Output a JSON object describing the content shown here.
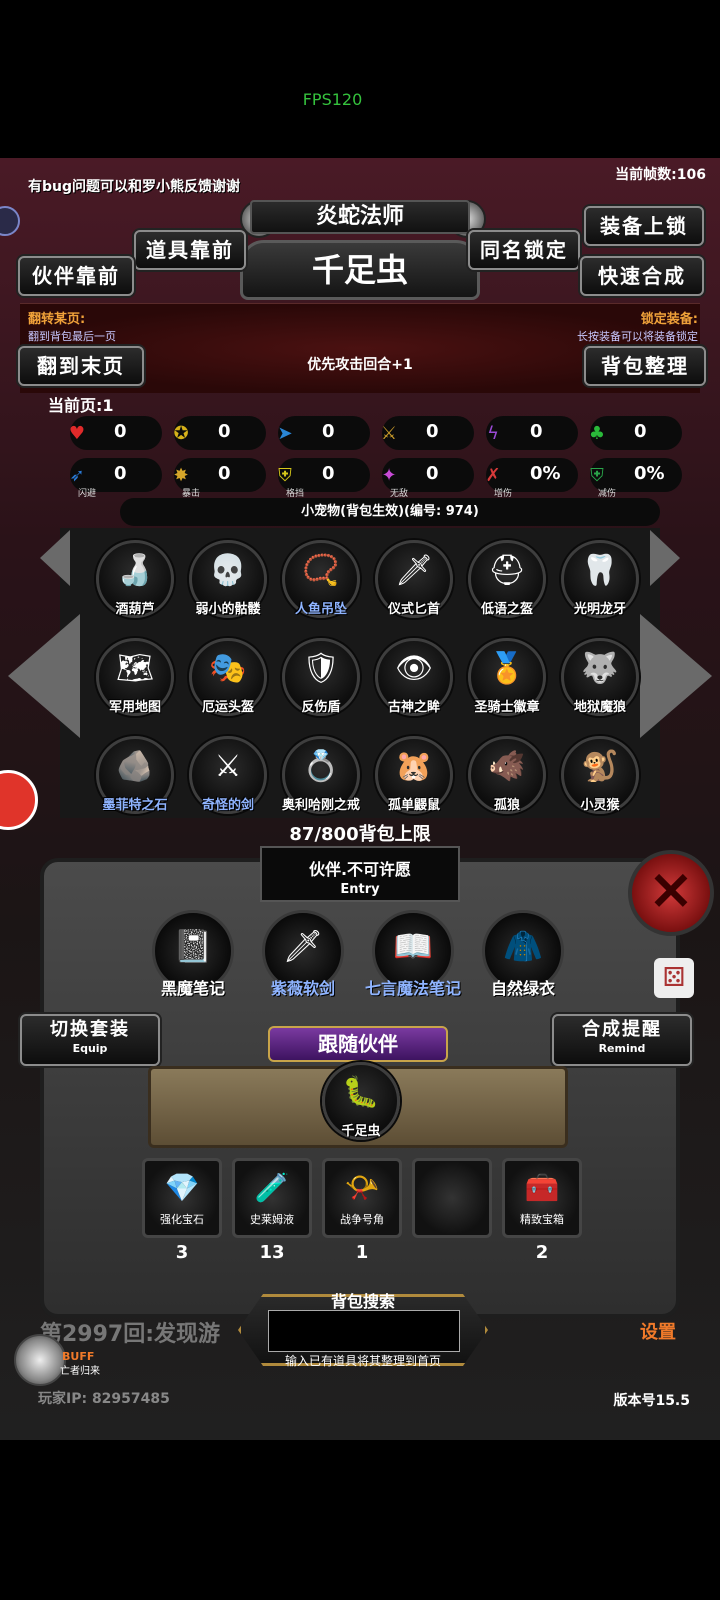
{
  "status": {
    "fps": "FPS120"
  },
  "header": {
    "bug_note": "有bug问题可以和罗小熊反馈谢谢",
    "frame_count": "当前帧数:106",
    "class_title": "炎蛇法师",
    "partner_name": "千足虫"
  },
  "buttons": {
    "items_front": "道具靠前",
    "partner_front": "伙伴靠前",
    "same_name_lock": "同名锁定",
    "equip_lock": "装备上锁",
    "quick_merge": "快速合成",
    "flip_to_last": "翻到末页",
    "bag_sort": "背包整理",
    "switch_set": "切换套装",
    "switch_set_sub": "Equip",
    "merge_remind": "合成提醒",
    "merge_remind_sub": "Remind",
    "follow_partner": "跟随伙伴",
    "setting": "设置"
  },
  "hints": {
    "flip_page_title": "翻转某页:",
    "flip_page_sub": "翻到背包最后一页",
    "lock_equip_title": "锁定装备:",
    "lock_equip_sub": "长按装备可以将装备锁定",
    "priority": "优先攻击回合+1",
    "current_page": "当前页:1"
  },
  "stats": [
    {
      "icon": "heart-icon",
      "value": "0",
      "tag": ""
    },
    {
      "icon": "armor-icon",
      "value": "0",
      "tag": ""
    },
    {
      "icon": "boot-icon",
      "value": "0",
      "tag": ""
    },
    {
      "icon": "sword-icon",
      "value": "0",
      "tag": ""
    },
    {
      "icon": "lightning-icon",
      "value": "0",
      "tag": ""
    },
    {
      "icon": "clover-icon",
      "value": "0",
      "tag": ""
    },
    {
      "icon": "dodge-icon",
      "value": "0",
      "tag": "闪避"
    },
    {
      "icon": "crit-icon",
      "value": "0",
      "tag": "暴击"
    },
    {
      "icon": "block-icon",
      "value": "0",
      "tag": "格挡"
    },
    {
      "icon": "invincible-icon",
      "value": "0",
      "tag": "无敌"
    },
    {
      "icon": "increase-damage-icon",
      "value": "0%",
      "tag": "增伤"
    },
    {
      "icon": "reduce-damage-icon",
      "value": "0%",
      "tag": "减伤"
    }
  ],
  "pet_line": "小宠物(背包生效)(编号: 974)",
  "bag_items": [
    {
      "name": "酒葫芦",
      "glyph": "🍶",
      "blue": false
    },
    {
      "name": "弱小的骷髅",
      "glyph": "💀",
      "blue": false
    },
    {
      "name": "人鱼吊坠",
      "glyph": "📿",
      "blue": true
    },
    {
      "name": "仪式匕首",
      "glyph": "🗡",
      "blue": false
    },
    {
      "name": "低语之盔",
      "glyph": "⛑",
      "blue": false
    },
    {
      "name": "光明龙牙",
      "glyph": "🦷",
      "blue": false
    },
    {
      "name": "军用地图",
      "glyph": "🗺",
      "blue": false
    },
    {
      "name": "厄运头盔",
      "glyph": "🎭",
      "blue": false
    },
    {
      "name": "反伤盾",
      "glyph": "🛡",
      "blue": false
    },
    {
      "name": "古神之眸",
      "glyph": "👁",
      "blue": false
    },
    {
      "name": "圣骑士徽章",
      "glyph": "🏅",
      "blue": false
    },
    {
      "name": "地狱魔狼",
      "glyph": "🐺",
      "blue": false
    },
    {
      "name": "墨菲特之石",
      "glyph": "🪨",
      "blue": true
    },
    {
      "name": "奇怪的剑",
      "glyph": "⚔",
      "blue": true
    },
    {
      "name": "奥利哈刚之戒",
      "glyph": "💍",
      "blue": false
    },
    {
      "name": "孤单鼹鼠",
      "glyph": "🐹",
      "blue": false
    },
    {
      "name": "孤狼",
      "glyph": "🐗",
      "blue": false
    },
    {
      "name": "小灵猴",
      "glyph": "🐒",
      "blue": false
    }
  ],
  "bag_capacity": "87/800背包上限",
  "entry": {
    "title": "伙伴.不可许愿",
    "sub": "Entry"
  },
  "equipment": [
    {
      "name": "黑魔笔记",
      "glyph": "📓",
      "blue": false
    },
    {
      "name": "紫薇软剑",
      "glyph": "🗡",
      "blue": true
    },
    {
      "name": "七言魔法笔记",
      "glyph": "📖",
      "blue": true
    },
    {
      "name": "自然绿衣",
      "glyph": "🧥",
      "blue": false
    }
  ],
  "follow_pet": {
    "name": "千足虫",
    "glyph": "🐛"
  },
  "consumables": [
    {
      "name": "强化宝石",
      "count": "3",
      "glyph": "💎"
    },
    {
      "name": "史莱姆液",
      "count": "13",
      "glyph": "🧪"
    },
    {
      "name": "战争号角",
      "count": "1",
      "glyph": "📯"
    },
    {
      "name": "",
      "count": "",
      "glyph": ""
    },
    {
      "name": "精致宝箱",
      "count": "2",
      "glyph": "🧰"
    }
  ],
  "search": {
    "title": "背包搜索",
    "hint": "输入已有道具将其整理到首页",
    "placeholder": ""
  },
  "footer": {
    "round": "第2997回:发现游",
    "buff": "BUFF",
    "buff_sub": "亡者归来",
    "ip_label": "玩家IP: 82957485",
    "version": "版本号15.5"
  },
  "colors": {
    "accent_orange": "#f0a23a",
    "fps_green": "#35c23d",
    "purple": "#7a3aa0"
  }
}
